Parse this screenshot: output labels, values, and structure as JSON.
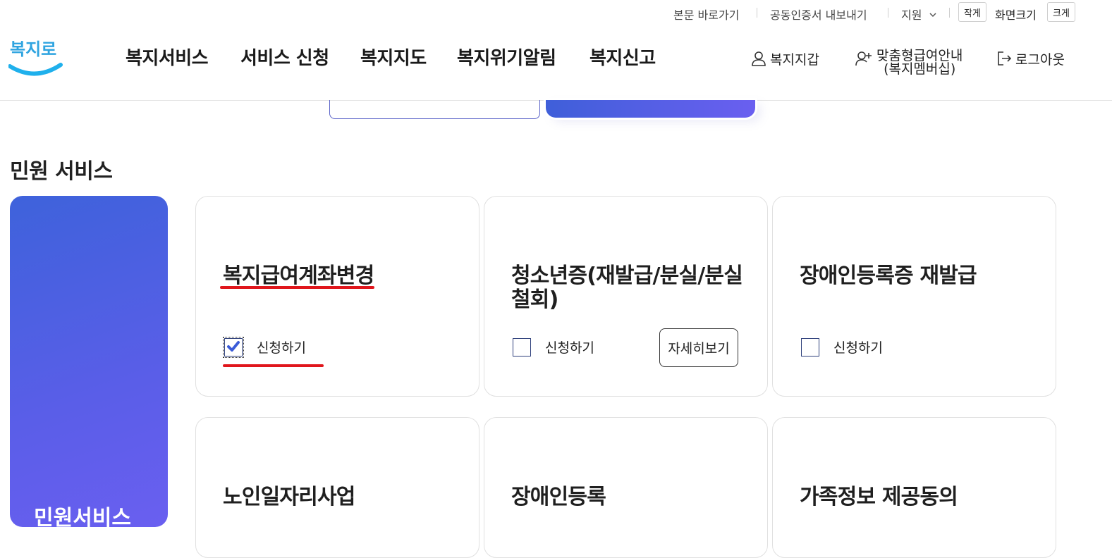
{
  "utility": {
    "skip_to_content": "본문 바로가기",
    "export_certificate": "공동인증서 내보내기",
    "support": "지원",
    "size_small": "작게",
    "screen_size": "화면크기",
    "size_large": "크게"
  },
  "logo": {
    "text": "복지로"
  },
  "gnb": [
    "복지서비스",
    "서비스 신청",
    "복지지도",
    "복지위기알림",
    "복지신고"
  ],
  "header_right": {
    "wallet": "복지지갑",
    "membership_line1": "맞춤형급여안내",
    "membership_line2": "(복지멤버십)",
    "logout": "로그아웃"
  },
  "section": {
    "title": "민원 서비스"
  },
  "side_card": {
    "label": "민원서비스"
  },
  "cards": [
    {
      "title_line1": "복지급여계좌변경",
      "title_line2": "",
      "apply_label": "신청하기",
      "checked": true,
      "detail_label": ""
    },
    {
      "title_line1": "청소년증(재발급/분실/분실",
      "title_line2": "철회)",
      "apply_label": "신청하기",
      "checked": false,
      "detail_label": "자세히보기"
    },
    {
      "title_line1": "장애인등록증 재발급",
      "title_line2": "",
      "apply_label": "신청하기",
      "checked": false,
      "detail_label": ""
    },
    {
      "title_line1": "노인일자리사업",
      "title_line2": ""
    },
    {
      "title_line1": "장애인등록",
      "title_line2": ""
    },
    {
      "title_line1": "가족정보 제공동의",
      "title_line2": ""
    }
  ],
  "colors": {
    "accent": "#4a5ee0",
    "annotation_red": "#e0161c",
    "check": "#3a5bd8"
  }
}
